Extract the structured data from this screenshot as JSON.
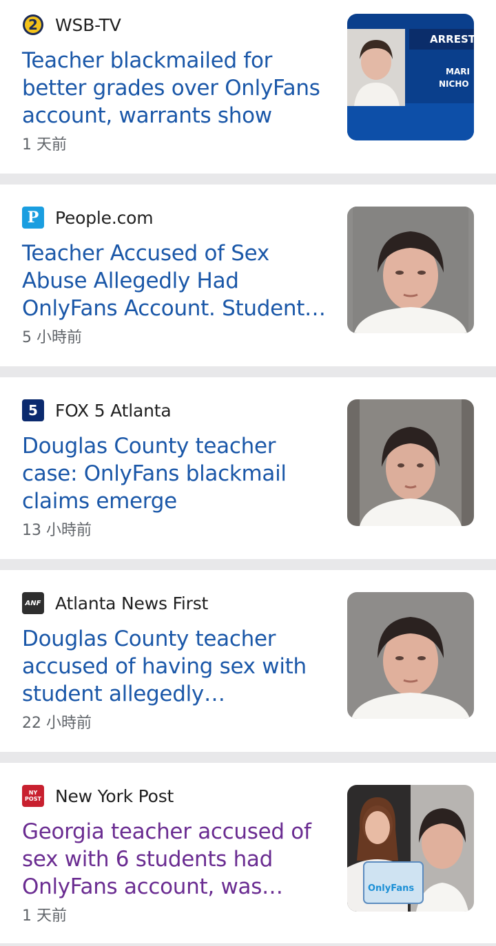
{
  "feed": {
    "items": [
      {
        "source": "WSB-TV",
        "source_icon": "wsb-channel-2-icon",
        "headline": "Teacher blackmailed for better grades over OnlyFans account, warrants show",
        "time": "1 天前",
        "visited": false,
        "thumb_overlay": {
          "line1": "ARREST",
          "line2": "MARI",
          "line3": "NICHO"
        }
      },
      {
        "source": "People.com",
        "source_icon": "people-p-icon",
        "source_logo_text": "P",
        "headline": "Teacher Accused of Sex Abuse Allegedly Had OnlyFans Account. Student…",
        "time": "5 小時前",
        "visited": false
      },
      {
        "source": "FOX 5 Atlanta",
        "source_icon": "fox5-icon",
        "source_logo_text": "5",
        "headline": "Douglas County teacher case: OnlyFans blackmail claims emerge",
        "time": "13 小時前",
        "visited": false
      },
      {
        "source": "Atlanta News First",
        "source_icon": "anf-icon",
        "source_logo_text": "ANF",
        "headline": "Douglas County teacher accused of having sex with student allegedly…",
        "time": "22 小時前",
        "visited": false
      },
      {
        "source": "New York Post",
        "source_icon": "nypost-icon",
        "source_logo_text": "NY POST",
        "headline": "Georgia teacher accused of sex with 6 students had OnlyFans account, was…",
        "time": "1 天前",
        "visited": true,
        "thumb_overlay": {
          "sign": "OnlyFans"
        }
      }
    ]
  },
  "colors": {
    "headline": "#1a57a8",
    "headline_visited": "#6a2c91",
    "time": "#5f6368",
    "divider": "#e8e8ea"
  }
}
